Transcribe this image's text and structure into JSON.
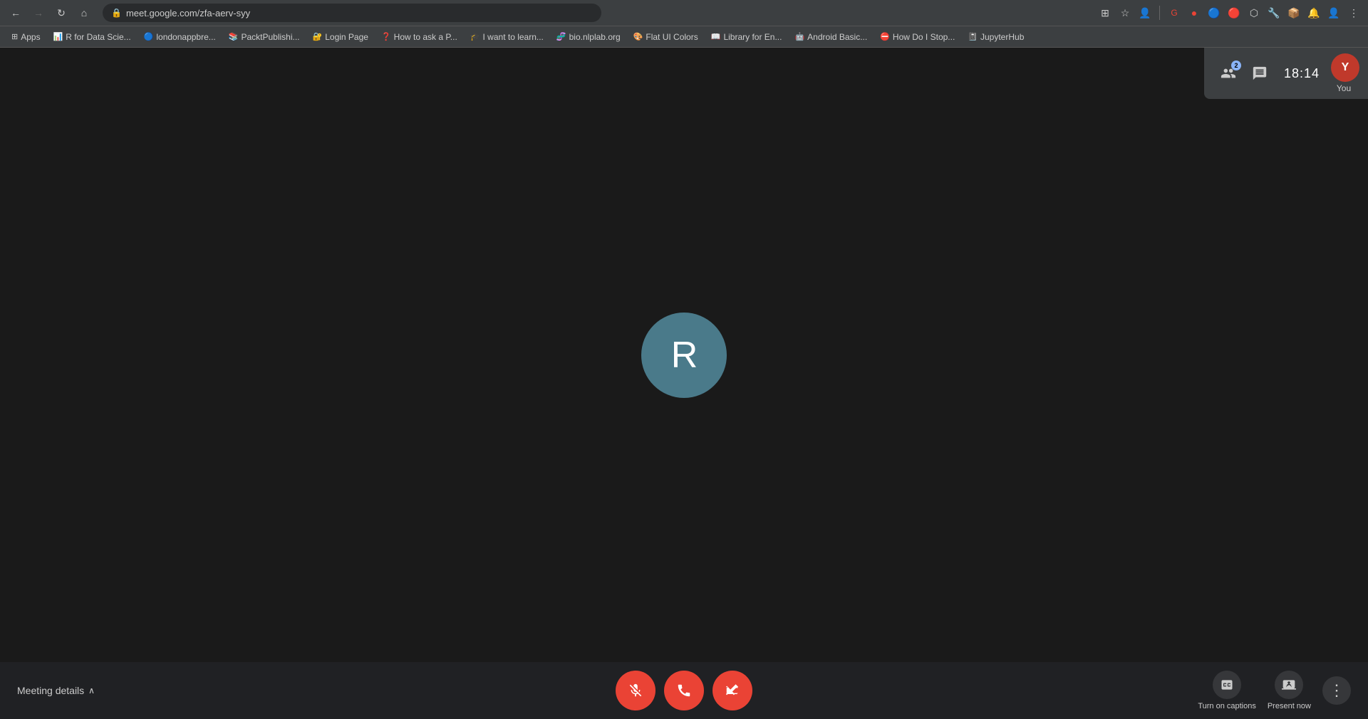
{
  "browser": {
    "url": "meet.google.com/zfa-aerv-syy",
    "nav_back_disabled": false,
    "nav_forward_disabled": true,
    "bookmarks": [
      {
        "label": "Apps",
        "icon": "⊞"
      },
      {
        "label": "R for Data Scie...",
        "icon": "📊"
      },
      {
        "label": "londonappbre...",
        "icon": "🔵"
      },
      {
        "label": "PacktPublishi...",
        "icon": "📚"
      },
      {
        "label": "Login Page",
        "icon": "🔐"
      },
      {
        "label": "How to ask a P...",
        "icon": "❓"
      },
      {
        "label": "I want to learn...",
        "icon": "🎓"
      },
      {
        "label": "bio.nlplab.org",
        "icon": "🧬"
      },
      {
        "label": "Flat UI Colors",
        "icon": "🎨"
      },
      {
        "label": "Library for En...",
        "icon": "📖"
      },
      {
        "label": "Android Basic...",
        "icon": "🤖"
      },
      {
        "label": "How Do I Stop...",
        "icon": "⛔"
      },
      {
        "label": "JupyterHub",
        "icon": "📓"
      }
    ]
  },
  "meet": {
    "timer": "18:14",
    "participant_initial": "R",
    "participant_count": "2",
    "user_label": "You",
    "user_initial": "Y",
    "meeting_details_label": "Meeting details",
    "controls": {
      "mute_label": "Mute",
      "end_call_label": "End call",
      "camera_label": "Camera"
    },
    "bottom_actions": {
      "captions_label": "Turn on captions",
      "present_label": "Present now",
      "more_label": "More options"
    },
    "icons": {
      "mic_off": "🎤",
      "call_end": "📞",
      "camera_off": "📷",
      "captions": "CC",
      "present": "⬆",
      "more": "⋮",
      "chevron_down": "∧",
      "lock": "🔒",
      "participants": "👥",
      "chat": "💬"
    }
  }
}
